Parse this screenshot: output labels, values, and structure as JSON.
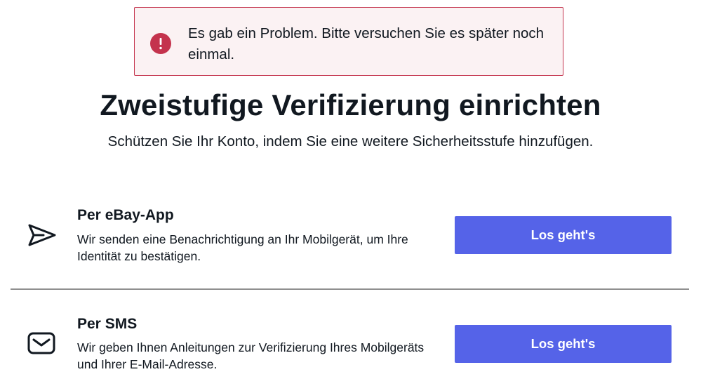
{
  "alert": {
    "icon": "exclamation-icon",
    "message": "Es gab ein Problem. Bitte versuchen Sie es später noch einmal.",
    "color": "#c4334d"
  },
  "header": {
    "title": "Zweistufige Verifizierung einrichten",
    "subtitle": "Schützen Sie Ihr Konto, indem Sie eine weitere Sicherheitsstufe hinzufügen."
  },
  "options": [
    {
      "icon": "send-arrow-icon",
      "title": "Per eBay-App",
      "description": "Wir senden eine Benachrichtigung an Ihr Mobilgerät, um Ihre Identität zu bestätigen.",
      "button_label": "Los geht's"
    },
    {
      "icon": "envelope-icon",
      "title": "Per SMS",
      "description": "Wir geben Ihnen Anleitungen zur Verifizierung Ihres Mobilgeräts und Ihrer E-Mail-Adresse.",
      "button_label": "Los geht's"
    }
  ],
  "colors": {
    "accent_button": "#5563e8",
    "error": "#c4334d",
    "text": "#111820"
  }
}
